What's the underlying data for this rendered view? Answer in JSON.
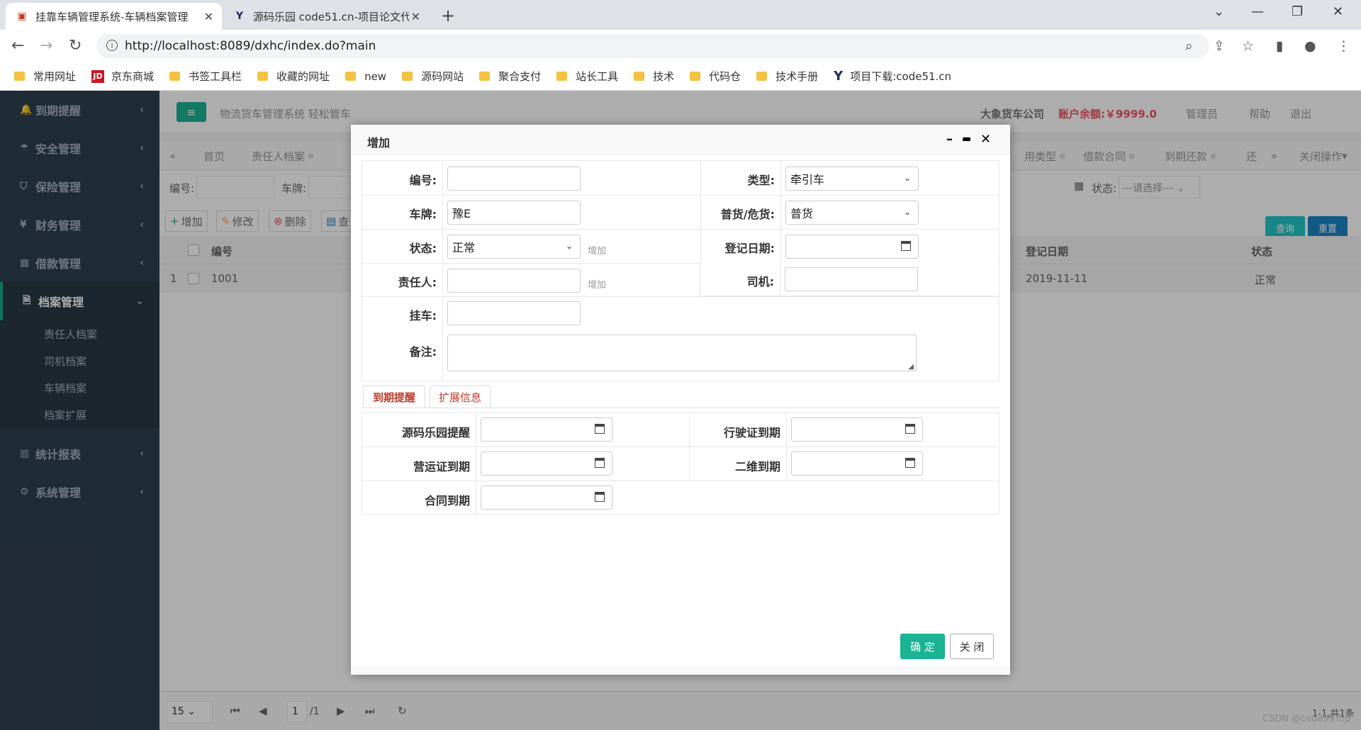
{
  "browser": {
    "tabs": [
      {
        "title": "挂靠车辆管理系统-车辆档案管理",
        "active": true
      },
      {
        "title": "源码乐园 code51.cn-项目论文代",
        "active": false
      }
    ],
    "url": "http://localhost:8089/dxhc/index.do?main",
    "bookmarks": [
      "常用网址",
      "京东商城",
      "书签工具栏",
      "收藏的网址",
      "new",
      "源码网站",
      "聚合支付",
      "站长工具",
      "技术",
      "代码仓",
      "技术手册",
      "项目下载:code51.cn"
    ]
  },
  "sidebar": {
    "menus": [
      {
        "label": "到期提醒",
        "icon": "bell-icon"
      },
      {
        "label": "安全管理",
        "icon": "umbrella-icon"
      },
      {
        "label": "保险管理",
        "icon": "shield-icon"
      },
      {
        "label": "财务管理",
        "icon": "yen-icon"
      },
      {
        "label": "借款管理",
        "icon": "table-icon"
      },
      {
        "label": "档案管理",
        "icon": "file-icon",
        "open": true
      },
      {
        "label": "统计报表",
        "icon": "bar-chart-icon"
      },
      {
        "label": "系统管理",
        "icon": "gear-icon"
      }
    ],
    "submenus": [
      "责任人档案",
      "司机档案",
      "车辆档案",
      "档案扩展"
    ]
  },
  "topnav": {
    "slogan": "物流货车管理系统 轻松管车",
    "company": "大象货车公司",
    "balance": "账户余额:￥9999.0",
    "admin": "管理员",
    "help": "帮助",
    "logout": "退出"
  },
  "pagetabs": {
    "items": [
      "首页",
      "责任人档案",
      "用类型",
      "借款合同",
      "到期还款",
      "还"
    ],
    "close_ops": "关闭操作"
  },
  "search": {
    "no_label": "编号:",
    "plate_label": "车牌:",
    "status_label": "状态:",
    "status_placeholder": "---请选择---",
    "query": "查询",
    "reset": "重置"
  },
  "toolbar": {
    "add": "增加",
    "edit": "修改",
    "delete": "删除",
    "view": "查"
  },
  "grid": {
    "headers": {
      "no": "编号",
      "date": "登记日期",
      "status": "状态"
    },
    "rows": [
      {
        "idx": "1",
        "no": "1001",
        "date": "2019-11-11",
        "status": "正常"
      }
    ]
  },
  "pager": {
    "size": "15",
    "page": "1",
    "total_pages": "/1",
    "summary": "1-1,共1条"
  },
  "watermark": "CSDN @code99Top",
  "modal": {
    "title": "增加",
    "labels": {
      "no": "编号:",
      "type": "类型:",
      "plate": "车牌:",
      "cargo": "普货/危货:",
      "status": "状态:",
      "reg_date": "登记日期:",
      "owner": "责任人:",
      "driver": "司机:",
      "trailer": "挂车:",
      "remark": "备注:"
    },
    "values": {
      "no": "",
      "type": "牵引车",
      "plate": "豫E",
      "cargo": "普货",
      "status": "正常",
      "reg_date": "",
      "owner": "",
      "driver": "",
      "trailer": "",
      "remark": ""
    },
    "hints": {
      "status_add": "增加",
      "owner_add": "增加"
    },
    "subtabs": [
      "到期提醒",
      "扩展信息"
    ],
    "expiry": {
      "l1": "源码乐园提醒",
      "l2": "行驶证到期",
      "l3": "营运证到期",
      "l4": "二维到期",
      "l5": "合同到期"
    },
    "ok": "确 定",
    "close": "关 闭"
  },
  "colors": {
    "sidebar": "#2f4050",
    "accent": "#1ab394",
    "query_btn": "#23c6c8",
    "reset_btn": "#1c84c6",
    "balance": "#ed5565"
  }
}
